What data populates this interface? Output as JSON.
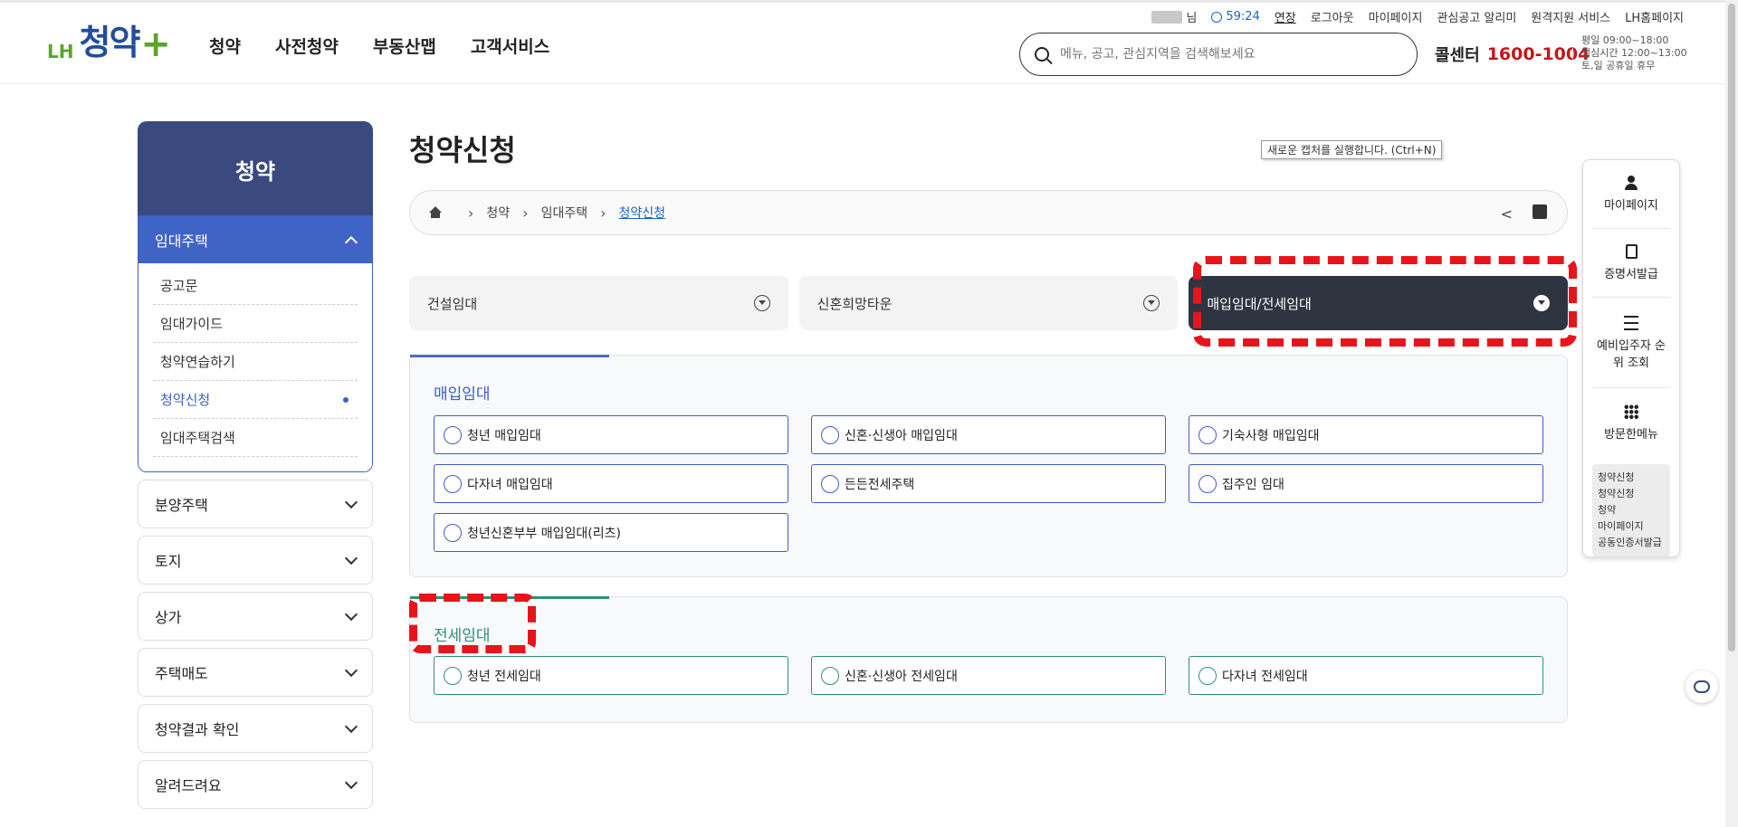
{
  "utility": {
    "user_suffix": "님",
    "timer": "59:24",
    "extend": "연장",
    "links": [
      "로그아웃",
      "마이페이지",
      "관심공고 알리미",
      "원격지원 서비스",
      "LH홈페이지"
    ]
  },
  "logo": {
    "lh": "LH",
    "name": "청약",
    "plus": "+"
  },
  "gnb": [
    "청약",
    "사전청약",
    "부동산맵",
    "고객서비스"
  ],
  "search": {
    "placeholder": "메뉴, 공고, 관심지역을 검색해보세요"
  },
  "call_center": {
    "label": "콜센터",
    "number": "1600-1004",
    "hours": [
      "평일 09:00~18:00",
      "점심시간 12:00~13:00",
      "토,일 공휴일 휴무"
    ]
  },
  "lnb": {
    "title": "청약",
    "open_group": "임대주택",
    "sub_items": [
      "공고문",
      "임대가이드",
      "청약연습하기",
      "청약신청",
      "임대주택검색"
    ],
    "active_sub": "청약신청",
    "groups": [
      "분양주택",
      "토지",
      "상가",
      "주택매도",
      "청약결과 확인",
      "알려드려요"
    ]
  },
  "page": {
    "title": "청약신청",
    "tooltip": "새로운 캡처를 실행합니다. (Ctrl+N)"
  },
  "breadcrumb": [
    "청약",
    "임대주택",
    "청약신청"
  ],
  "tabs": [
    {
      "label": "건설임대"
    },
    {
      "label": "신혼희망타운"
    },
    {
      "label": "매입임대/전세임대"
    }
  ],
  "active_tab": "매입임대/전세임대",
  "sections": [
    {
      "title": "매입임대",
      "options": [
        "청년 매입임대",
        "신혼·신생아 매입임대",
        "기숙사형 매입임대",
        "다자녀 매입임대",
        "든든전세주택",
        "집주인 임대",
        "청년신혼부부 매입임대(리츠)"
      ]
    },
    {
      "title": "전세임대",
      "options": [
        "청년 전세임대",
        "신혼·신생아 전세임대",
        "다자녀 전세임대"
      ]
    }
  ],
  "quick_menu": {
    "items": [
      "마이페이지",
      "증명서발급",
      "예비입주자 순위 조회",
      "방문한메뉴"
    ],
    "recent": [
      "청약신청",
      "청약신청",
      "청약",
      "마이페이지",
      "공동인증서발급"
    ]
  },
  "colors": {
    "brand_navy": "#3a4a7e",
    "accent_blue": "#3f5ec4",
    "accent_green": "#2f8f7c",
    "active_tab": "#2f3441",
    "highlight_red": "#e8141c",
    "call_red": "#c4161c"
  }
}
